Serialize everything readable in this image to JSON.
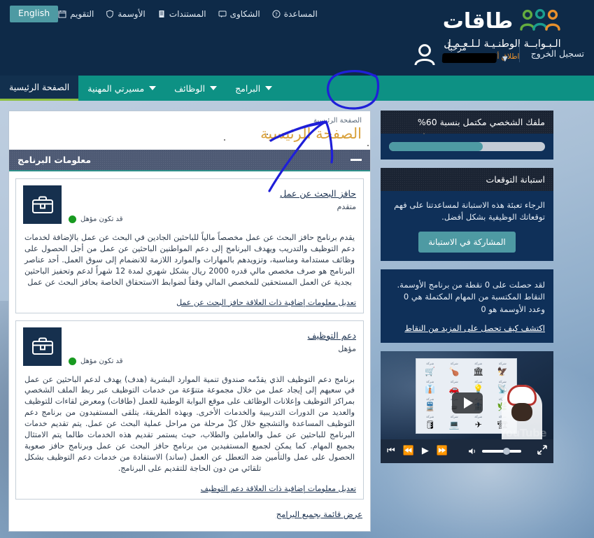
{
  "header": {
    "lang_button": "English",
    "util_links": [
      {
        "label": "التقويم",
        "icon": "calendar-icon"
      },
      {
        "label": "الأوسمة",
        "icon": "shield-icon"
      },
      {
        "label": "المستندات",
        "icon": "document-icon"
      },
      {
        "label": "الشكاوى",
        "icon": "chat-icon"
      },
      {
        "label": "المساعدة",
        "icon": "question-icon"
      }
    ],
    "logo": {
      "word": "طاقات",
      "subtitle": "الـبـوابــة الوطنـيـة لـلـعـمـل",
      "tagline": "اطلاق أوّلى",
      "mark": "three-people-icon"
    },
    "user": {
      "greeting": "مرحباً",
      "name_redacted": "",
      "logout": "تسجيل الخروج",
      "avatar": "user-avatar-icon",
      "caret": "chevron-down-icon"
    }
  },
  "nav": {
    "items": [
      {
        "label": "الصفحة الرئيسية",
        "active": true,
        "has_caret": false
      },
      {
        "label": "مسيرتي المهنية",
        "active": false,
        "has_caret": true
      },
      {
        "label": "الوظائف",
        "active": false,
        "has_caret": true
      },
      {
        "label": "البرامج",
        "active": false,
        "has_caret": true
      }
    ]
  },
  "sidebar": {
    "profile": {
      "title": "ملفك الشخصي مكتمل بنسبة 60%",
      "percent": 60
    },
    "survey": {
      "title": "استبانة التوقعات",
      "text": "الرجاء تعبئة هذه الاستبانة لمساعدتنا على فهم توقعاتك الوظيفية بشكل أفضل.",
      "button": "المشاركة في الاستبانة"
    },
    "badges": {
      "line1": "لقد حصلت على 0 نقطة من برنامج الأوسمة.",
      "line2": "النقاط المكتسبة من المهام المكتملة هي 0 وعدد الأوسمة هو 0",
      "link": "اكتشف كيف تحصل على المزيد من النقاط"
    },
    "video": {
      "play": "play-button",
      "tiles": [
        {
          "label": "شركة",
          "glyph": "🦅"
        },
        {
          "label": "شركة",
          "glyph": "🏛"
        },
        {
          "label": "شركة",
          "glyph": "🍗"
        },
        {
          "label": "شركة",
          "glyph": "🛒"
        },
        {
          "label": "شركة",
          "glyph": "📡"
        },
        {
          "label": "شركة",
          "glyph": "💡"
        },
        {
          "label": "شركة",
          "glyph": "🚗"
        },
        {
          "label": "شركة",
          "glyph": "👔"
        },
        {
          "label": "شركة",
          "glyph": "🌿"
        },
        {
          "label": "شركة",
          "glyph": "🏦"
        },
        {
          "label": "شركة",
          "glyph": "☕"
        },
        {
          "label": "شركة",
          "glyph": "🚆"
        },
        {
          "label": "شركة",
          "glyph": "🏗"
        },
        {
          "label": "شركة",
          "glyph": "✈"
        },
        {
          "label": "شركة",
          "glyph": "💻"
        },
        {
          "label": "شركة",
          "glyph": "🛢"
        }
      ],
      "controls": {
        "prev": "⏮",
        "rewind": "⏪",
        "play": "▶",
        "forward": "⏩",
        "volume": "volume-icon",
        "volume_level": 52,
        "fullscreen": "fullscreen-icon"
      },
      "watermark": "YouTube"
    }
  },
  "main": {
    "breadcrumb": "الصفحة الرئيسية",
    "title": "الصفحة الرئيسية",
    "panel": {
      "title": "معلومات البرنامج",
      "toggle": "minimize-icon"
    },
    "programs": [
      {
        "name": "حافز البحث عن عمل",
        "status": "متقدم",
        "eligibility": "قد تكون مؤهل",
        "eligibility_color": "#189a20",
        "icon": "briefcase-icon",
        "description": "يقدم برنامج حافز البحث عن عمل مخصصاً مالياً للباحثين الجادين في البحث عن عمل بالإضافة لخدمات دعم التوظيف والتدريب ويهدف البرنامج إلى دعم المواطنين الباحثين عن عمل من أجل الحصول على وظائف مستدامة ومناسبة، وتزويدهم بالمهارات والموارد اللازمة للانضمام إلى سوق العمل. أحد عناصر البرنامج هو صرف مخصص مالي قدره 2000 ريال بشكل شهري لمدة 12 شهراً لدعم وتحفيز الباحثين بجدية عن العمل المستحقين للمخصص المالي وفقاً لضوابط الاستحقاق الخاصة بحافز البحث عن عمل",
        "link": "تعديل معلومات إضافية ذات العلاقة حافز البحث عن عمل"
      },
      {
        "name": "دعم التوظيف",
        "status": "مؤهل",
        "eligibility": "قد تكون مؤهل",
        "eligibility_color": "#189a20",
        "icon": "briefcase-icon",
        "description": "برنامج دعم التوظيف الذي يقدّمه صندوق تنمية الموارد البشرية (هدف) يهدف لدعم الباحثين عن عمل في سعيهم إلى إيجاد عمل من خلال مجموعة متنوّعة من خدمات التوظيف عبر ربط الملف الشخصي بمراكز التوظيف وإعلانات الوظائف على موقع البوابة الوطنية للعمل (طاقات) ومعرض لقاءات للتوظيف والعديد من الدورات التدريبية والخدمات الأخرى. وبهذه الطريقة، يتلقى المستفيدون من برنامج دعم التوظيف المساعدة والتشجيع خلال كلّ مرحلة من مراحل عملية البحث عن عمل. يتم تقديم خدمات البرنامج للباحثين عن عمل والعاملين والطلاب، حيث يستمر تقديم هذه الخدمات طالما يتم الامتثال بجميع المهام. كما يمكن لجميع المستفيدين من برنامج حافز البحث عن عمل وبرنامج حافز صعوبة الحصول على عمل والتأمين ضد التعطل عن العمل (ساند) الاستفادة من خدمات دعم التوظيف بشكل تلقائي من دون الحاجة للتقديم على البرنامج.",
        "link": "تعديل معلومات إضافية ذات العلاقة دعم التوظيف"
      }
    ],
    "all_programs_link": "عرض قائمة بجميع البرامج"
  },
  "annotations": {
    "circle_target": "البرامج",
    "ink_color": "#1f1fd8"
  }
}
